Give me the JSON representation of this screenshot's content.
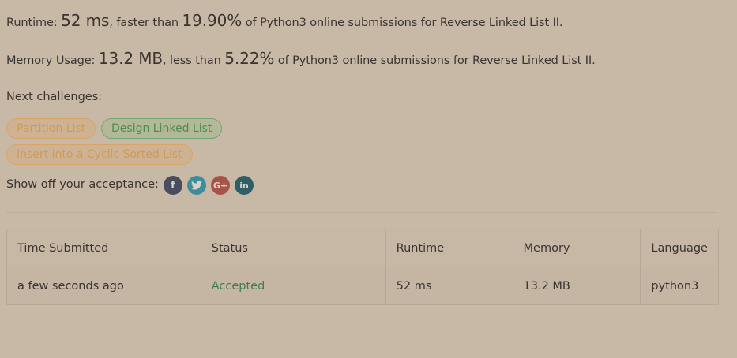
{
  "summary": {
    "runtime_label": "Runtime:",
    "runtime_value": "52 ms",
    "runtime_faster_than": ", faster than",
    "runtime_percent": "19.90%",
    "runtime_suffix": "of Python3 online submissions for Reverse Linked List II.",
    "memory_label": "Memory Usage:",
    "memory_value": "13.2 MB",
    "memory_less_than": ", less than",
    "memory_percent": "5.22%",
    "memory_suffix": "of Python3 online submissions for Reverse Linked List II."
  },
  "next_challenges": {
    "label": "Next challenges:",
    "items": [
      {
        "label": "Partition List",
        "difficulty": "medium",
        "color": "#d19a58"
      },
      {
        "label": "Design Linked List",
        "difficulty": "easy",
        "color": "#4f8a56"
      },
      {
        "label": "Insert into a Cyclic Sorted List",
        "difficulty": "medium",
        "color": "#d19a58"
      }
    ]
  },
  "share": {
    "label": "Show off your acceptance:",
    "icons": [
      "facebook-icon",
      "twitter-icon",
      "google-plus-icon",
      "linkedin-icon"
    ],
    "facebook_glyph": "f",
    "google_glyph": "G+",
    "linkedin_glyph": "in"
  },
  "submissions": {
    "columns": [
      "Time Submitted",
      "Status",
      "Runtime",
      "Memory",
      "Language"
    ],
    "rows": [
      {
        "time": "a few seconds ago",
        "status": "Accepted",
        "runtime": "52 ms",
        "memory": "13.2 MB",
        "language": "python3"
      }
    ],
    "accepted_color": "#3f7d4f"
  }
}
